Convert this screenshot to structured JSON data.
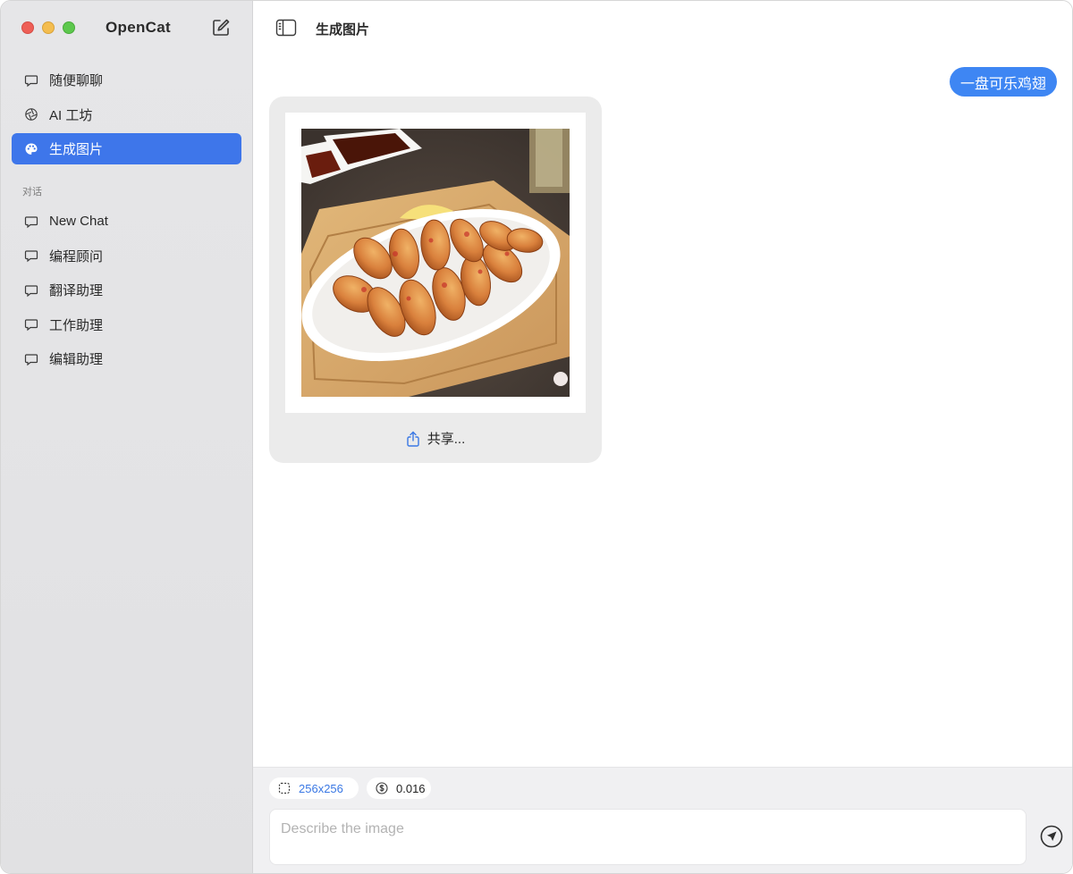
{
  "app": {
    "title": "OpenCat"
  },
  "sidebar": {
    "items": [
      {
        "label": "随便聊聊",
        "icon": "chat-bubble-icon"
      },
      {
        "label": "AI 工坊",
        "icon": "aperture-icon"
      },
      {
        "label": "生成图片",
        "icon": "palette-icon",
        "active": true
      }
    ],
    "section_label": "对话",
    "conversations": [
      {
        "label": "New Chat",
        "icon": "chat-bubble-icon"
      },
      {
        "label": "编程顾问",
        "icon": "chat-bubble-icon"
      },
      {
        "label": "翻译助理",
        "icon": "chat-bubble-icon"
      },
      {
        "label": "工作助理",
        "icon": "chat-bubble-icon"
      },
      {
        "label": "编辑助理",
        "icon": "chat-bubble-icon"
      }
    ]
  },
  "main": {
    "title": "生成图片",
    "user_message": "一盘可乐鸡翅",
    "share_label": "共享...",
    "image_size": "256x256",
    "cost": "0.016",
    "input_placeholder": "Describe the image",
    "input_value": ""
  },
  "colors": {
    "accent": "#3e76ea",
    "user_bubble": "#3e86f3",
    "sidebar_bg": "#e3e3e5"
  }
}
